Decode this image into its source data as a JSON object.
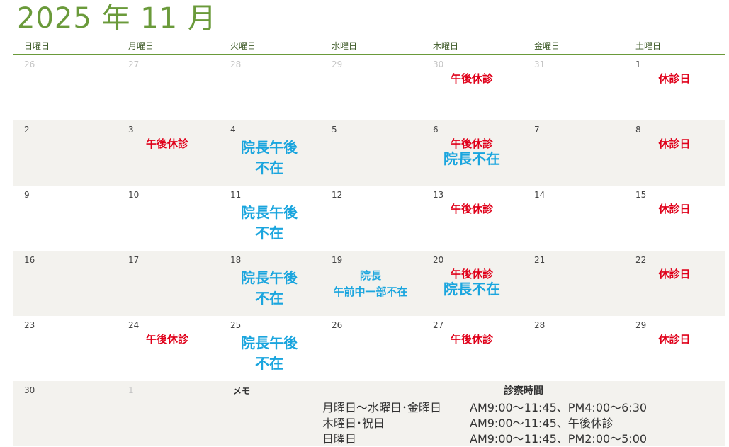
{
  "calendar": {
    "title": "2025 年 11 月",
    "weekdays": [
      "日曜日",
      "月曜日",
      "火曜日",
      "水曜日",
      "木曜日",
      "金曜日",
      "土曜日"
    ],
    "weeks": [
      {
        "days": [
          {
            "num": "26",
            "muted": true
          },
          {
            "num": "27",
            "muted": true
          },
          {
            "num": "28",
            "muted": true
          },
          {
            "num": "29",
            "muted": true
          },
          {
            "num": "30",
            "muted": true,
            "notes": [
              {
                "text": "午後休診",
                "style": "red"
              }
            ]
          },
          {
            "num": "31",
            "muted": true
          },
          {
            "num": "1",
            "notes": [
              {
                "text": "休診日",
                "style": "red"
              }
            ]
          }
        ]
      },
      {
        "days": [
          {
            "num": "2"
          },
          {
            "num": "3",
            "notes": [
              {
                "text": "午後休診",
                "style": "red"
              }
            ]
          },
          {
            "num": "4",
            "notes": [
              {
                "text": "院長午後\n不在",
                "style": "blue-lg"
              }
            ]
          },
          {
            "num": "5"
          },
          {
            "num": "6",
            "notes": [
              {
                "text": "午後休診",
                "style": "red"
              },
              {
                "text": "院長不在",
                "style": "blue-lg"
              }
            ]
          },
          {
            "num": "7"
          },
          {
            "num": "8",
            "notes": [
              {
                "text": "休診日",
                "style": "red"
              }
            ]
          }
        ]
      },
      {
        "days": [
          {
            "num": "9"
          },
          {
            "num": "10"
          },
          {
            "num": "11",
            "notes": [
              {
                "text": "院長午後\n不在",
                "style": "blue-lg"
              }
            ]
          },
          {
            "num": "12"
          },
          {
            "num": "13",
            "notes": [
              {
                "text": "午後休診",
                "style": "red"
              }
            ]
          },
          {
            "num": "14"
          },
          {
            "num": "15",
            "notes": [
              {
                "text": "休診日",
                "style": "red"
              }
            ]
          }
        ]
      },
      {
        "days": [
          {
            "num": "16"
          },
          {
            "num": "17"
          },
          {
            "num": "18",
            "notes": [
              {
                "text": "院長午後\n不在",
                "style": "blue-lg"
              }
            ]
          },
          {
            "num": "19",
            "notes": [
              {
                "text": "院長\n午前中一部不在",
                "style": "blue-sm"
              }
            ]
          },
          {
            "num": "20",
            "notes": [
              {
                "text": "午後休診",
                "style": "red"
              },
              {
                "text": "院長不在",
                "style": "blue-lg"
              }
            ]
          },
          {
            "num": "21"
          },
          {
            "num": "22",
            "notes": [
              {
                "text": "休診日",
                "style": "red"
              }
            ]
          }
        ]
      },
      {
        "days": [
          {
            "num": "23"
          },
          {
            "num": "24",
            "notes": [
              {
                "text": "午後休診",
                "style": "red"
              }
            ]
          },
          {
            "num": "25",
            "notes": [
              {
                "text": "院長午後\n不在",
                "style": "blue-lg"
              }
            ]
          },
          {
            "num": "26"
          },
          {
            "num": "27",
            "notes": [
              {
                "text": "午後休診",
                "style": "red"
              }
            ]
          },
          {
            "num": "28"
          },
          {
            "num": "29",
            "notes": [
              {
                "text": "休診日",
                "style": "red"
              }
            ]
          }
        ]
      },
      {
        "days": [
          {
            "num": "30"
          },
          {
            "num": "1",
            "muted": true
          }
        ]
      }
    ]
  },
  "memo": {
    "label": "メモ",
    "hours_title": "診察時間",
    "hours": [
      {
        "days": "月曜日～水曜日･金曜日",
        "time": "AM9:00～11:45、PM4:00～6:30"
      },
      {
        "days": "木曜日･祝日",
        "time": "AM9:00～11:45、午後休診"
      },
      {
        "days": "日曜日",
        "time": "AM9:00～11:45、PM2:00～5:00"
      }
    ]
  },
  "colors": {
    "title_green": "#6a9a3a",
    "closed_red": "#e0001a",
    "absent_blue": "#1aa5de",
    "shaded_row": "#f3f2ee"
  }
}
